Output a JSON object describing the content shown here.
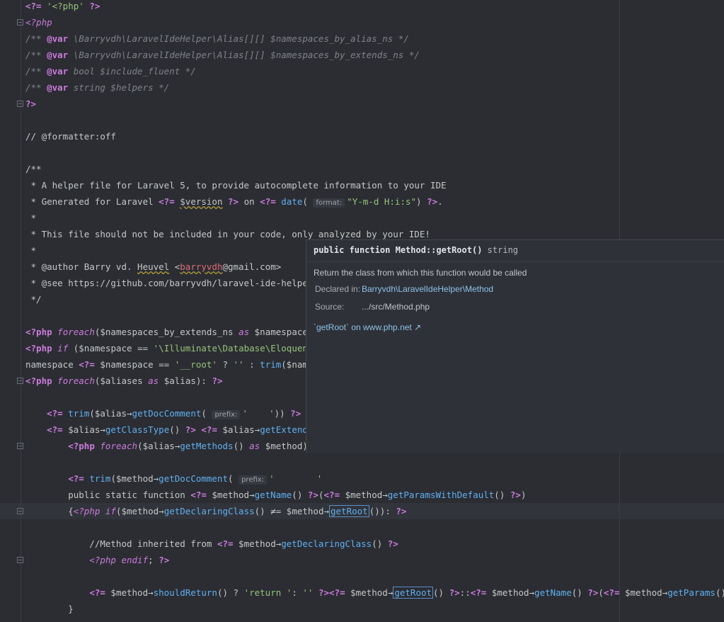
{
  "code_lines": [
    {
      "fold": false,
      "segs": [
        [
          "tag",
          "<?="
        ],
        [
          "v",
          " "
        ],
        [
          "s",
          "'<?php'"
        ],
        [
          "v",
          " "
        ],
        [
          "tag",
          "?>"
        ]
      ]
    },
    {
      "fold": true,
      "segs": [
        [
          "tagi",
          "<?php"
        ]
      ]
    },
    {
      "fold": false,
      "segs": [
        [
          "c",
          "/** "
        ],
        [
          "tag",
          "@var"
        ],
        [
          "c",
          " \\Barryvdh\\LaravelIdeHelper\\Alias[][] $namespaces_by_alias_ns */"
        ]
      ]
    },
    {
      "fold": false,
      "segs": [
        [
          "c",
          "/** "
        ],
        [
          "tag",
          "@var"
        ],
        [
          "c",
          " \\Barryvdh\\LaravelIdeHelper\\Alias[][] $namespaces_by_extends_ns */"
        ]
      ]
    },
    {
      "fold": false,
      "segs": [
        [
          "c",
          "/** "
        ],
        [
          "tag",
          "@var"
        ],
        [
          "c",
          " bool $include_fluent */"
        ]
      ]
    },
    {
      "fold": false,
      "segs": [
        [
          "c",
          "/** "
        ],
        [
          "tag",
          "@var"
        ],
        [
          "c",
          " string $helpers */"
        ]
      ]
    },
    {
      "fold": true,
      "segs": [
        [
          "tag",
          "?>"
        ]
      ]
    },
    {
      "fold": false,
      "segs": []
    },
    {
      "fold": false,
      "segs": [
        [
          "v",
          "// @formatter:off"
        ]
      ]
    },
    {
      "fold": false,
      "segs": []
    },
    {
      "fold": false,
      "segs": [
        [
          "v",
          "/**"
        ]
      ]
    },
    {
      "fold": false,
      "segs": [
        [
          "v",
          " * A helper file for Laravel 5, to provide autocomplete information to your IDE"
        ]
      ]
    },
    {
      "fold": false,
      "segs": [
        [
          "v",
          " * Generated for Laravel "
        ],
        [
          "tag",
          "<?="
        ],
        [
          "v",
          " "
        ],
        [
          "sq",
          "$version"
        ],
        [
          "v",
          " "
        ],
        [
          "tag",
          "?>"
        ],
        [
          "v",
          " on "
        ],
        [
          "tag",
          "<?="
        ],
        [
          "v",
          " "
        ],
        [
          "fn",
          "date"
        ],
        [
          "v",
          "( "
        ],
        [
          "hint",
          "format:"
        ],
        [
          "s",
          "\"Y-m-d H:i:s\""
        ],
        [
          "v",
          ") "
        ],
        [
          "tag",
          "?>"
        ],
        [
          "v",
          "."
        ]
      ]
    },
    {
      "fold": false,
      "segs": [
        [
          "v",
          " *"
        ]
      ]
    },
    {
      "fold": false,
      "segs": [
        [
          "v",
          " * This file should not be included in your code, only analyzed by your IDE!"
        ]
      ]
    },
    {
      "fold": false,
      "segs": [
        [
          "v",
          " *"
        ]
      ]
    },
    {
      "fold": false,
      "segs": [
        [
          "v",
          " * @author Barry vd. "
        ],
        [
          "sq",
          "Heuvel"
        ],
        [
          "v",
          " <"
        ],
        [
          "sqr",
          "barryvdh"
        ],
        [
          "v",
          "@gmail.com>"
        ]
      ]
    },
    {
      "fold": false,
      "segs": [
        [
          "v",
          " * @see https://github.com/barryvdh/laravel-ide-helper"
        ]
      ]
    },
    {
      "fold": false,
      "segs": [
        [
          "v",
          " */"
        ]
      ]
    },
    {
      "fold": false,
      "segs": []
    },
    {
      "fold": false,
      "segs": [
        [
          "tag",
          "<?php"
        ],
        [
          "v",
          " "
        ],
        [
          "kwi",
          "foreach"
        ],
        [
          "v",
          "($namespaces_by_extends_ns "
        ],
        [
          "kwi",
          "as"
        ],
        [
          "v",
          " $namespace ⇒"
        ]
      ]
    },
    {
      "fold": false,
      "segs": [
        [
          "tag",
          "<?php"
        ],
        [
          "v",
          " "
        ],
        [
          "kwi",
          "if"
        ],
        [
          "v",
          " ($namespace == "
        ],
        [
          "s",
          "'\\Illuminate\\Database\\Eloquent'"
        ],
        [
          "v",
          "):"
        ]
      ]
    },
    {
      "fold": false,
      "segs": [
        [
          "v",
          "namespace "
        ],
        [
          "tag",
          "<?="
        ],
        [
          "v",
          " $namespace == "
        ],
        [
          "s",
          "'__root'"
        ],
        [
          "v",
          " ? "
        ],
        [
          "s",
          "''"
        ],
        [
          "v",
          " : "
        ],
        [
          "fn",
          "trim"
        ],
        [
          "v",
          "($namespa"
        ]
      ]
    },
    {
      "fold": true,
      "segs": [
        [
          "tag",
          "<?php"
        ],
        [
          "v",
          " "
        ],
        [
          "kwi",
          "foreach"
        ],
        [
          "v",
          "($aliases "
        ],
        [
          "kwi",
          "as"
        ],
        [
          "v",
          " $alias): "
        ],
        [
          "tag",
          "?>"
        ]
      ]
    },
    {
      "fold": false,
      "segs": []
    },
    {
      "fold": false,
      "segs": [
        [
          "v",
          "    "
        ],
        [
          "tag",
          "<?="
        ],
        [
          "v",
          " "
        ],
        [
          "fn",
          "trim"
        ],
        [
          "v",
          "($alias→"
        ],
        [
          "fn",
          "getDocComment"
        ],
        [
          "v",
          "( "
        ],
        [
          "hint",
          "prefix:"
        ],
        [
          "s",
          "'    '"
        ],
        [
          "v",
          ")) "
        ],
        [
          "tag",
          "?>"
        ]
      ]
    },
    {
      "fold": false,
      "segs": [
        [
          "v",
          "    "
        ],
        [
          "tag",
          "<?="
        ],
        [
          "v",
          " $alias→"
        ],
        [
          "fn",
          "getClassType"
        ],
        [
          "v",
          "() "
        ],
        [
          "tag",
          "?>"
        ],
        [
          "v",
          " "
        ],
        [
          "tag",
          "<?="
        ],
        [
          "v",
          " $alias→"
        ],
        [
          "fn",
          "getExtendsC"
        ]
      ]
    },
    {
      "fold": true,
      "segs": [
        [
          "v",
          "        "
        ],
        [
          "tag",
          "<?php"
        ],
        [
          "v",
          " "
        ],
        [
          "kwi",
          "foreach"
        ],
        [
          "v",
          "($alias→"
        ],
        [
          "fn",
          "getMethods"
        ],
        [
          "v",
          "() "
        ],
        [
          "kwi",
          "as"
        ],
        [
          "v",
          " $method): "
        ],
        [
          "tag",
          "?"
        ]
      ]
    },
    {
      "fold": false,
      "segs": []
    },
    {
      "fold": false,
      "segs": [
        [
          "v",
          "        "
        ],
        [
          "tag",
          "<?="
        ],
        [
          "v",
          " "
        ],
        [
          "fn",
          "trim"
        ],
        [
          "v",
          "($method→"
        ],
        [
          "fn",
          "getDocComment"
        ],
        [
          "v",
          "( "
        ],
        [
          "hint",
          "prefix:"
        ],
        [
          "s",
          "'        '"
        ]
      ]
    },
    {
      "fold": false,
      "segs": [
        [
          "v",
          "        public static function "
        ],
        [
          "tag",
          "<?="
        ],
        [
          "v",
          " $method→"
        ],
        [
          "fn",
          "getName"
        ],
        [
          "v",
          "() "
        ],
        [
          "tag",
          "?>"
        ],
        [
          "v",
          "("
        ],
        [
          "tag",
          "<?="
        ],
        [
          "v",
          " $method→"
        ],
        [
          "fn",
          "getParamsWithDefault"
        ],
        [
          "v",
          "() "
        ],
        [
          "tag",
          "?>"
        ],
        [
          "v",
          ")"
        ]
      ]
    },
    {
      "fold": true,
      "segs": [
        [
          "v",
          "        {"
        ],
        [
          "tagi",
          "<?php"
        ],
        [
          "v",
          " "
        ],
        [
          "kwi",
          "if"
        ],
        [
          "v",
          "($method→"
        ],
        [
          "fn",
          "getDeclaringClass"
        ],
        [
          "v",
          "() ≠= $method→"
        ],
        [
          "hlfn",
          "getRoot"
        ],
        [
          "v",
          "()): "
        ],
        [
          "tag",
          "?>"
        ]
      ]
    },
    {
      "fold": false,
      "segs": []
    },
    {
      "fold": false,
      "segs": [
        [
          "v",
          "            //Method inherited from "
        ],
        [
          "tag",
          "<?="
        ],
        [
          "v",
          " $method→"
        ],
        [
          "fn",
          "getDeclaringClass"
        ],
        [
          "v",
          "() "
        ],
        [
          "tag",
          "?>"
        ]
      ]
    },
    {
      "fold": true,
      "segs": [
        [
          "v",
          "            "
        ],
        [
          "tagi",
          "<?php"
        ],
        [
          "v",
          " "
        ],
        [
          "kwi",
          "endif"
        ],
        [
          "v",
          "; "
        ],
        [
          "tag",
          "?>"
        ]
      ]
    },
    {
      "fold": false,
      "segs": []
    },
    {
      "fold": false,
      "segs": [
        [
          "v",
          "            "
        ],
        [
          "tag",
          "<?="
        ],
        [
          "v",
          " $method→"
        ],
        [
          "fn",
          "shouldReturn"
        ],
        [
          "v",
          "() ? "
        ],
        [
          "s",
          "'return '"
        ],
        [
          "v",
          ": "
        ],
        [
          "s",
          "''"
        ],
        [
          "v",
          " "
        ],
        [
          "tag",
          "?>"
        ],
        [
          "tag",
          "<?="
        ],
        [
          "v",
          " $method→"
        ],
        [
          "hlfn",
          "getRoot"
        ],
        [
          "v",
          "() "
        ],
        [
          "tag",
          "?>"
        ],
        [
          "v",
          "::"
        ],
        [
          "tag",
          "<?="
        ],
        [
          "v",
          " $method→"
        ],
        [
          "fn",
          "getName"
        ],
        [
          "v",
          "() "
        ],
        [
          "tag",
          "?>"
        ],
        [
          "v",
          "("
        ],
        [
          "tag",
          "<?="
        ],
        [
          "v",
          " $method→"
        ],
        [
          "fn",
          "getParams"
        ],
        [
          "v",
          "() "
        ],
        [
          "tag",
          "?>"
        ],
        [
          "v",
          ");"
        ]
      ]
    },
    {
      "fold": false,
      "segs": [
        [
          "v",
          "        }"
        ]
      ]
    }
  ],
  "popup": {
    "keyword": "public function",
    "name": "Method::getRoot()",
    "return_type": "string",
    "description": "Return the class from which this function would be called",
    "declared_label": "Declared in:",
    "declared_value": "Barryvdh\\LaravelIdeHelper\\Method",
    "source_label": "Source:",
    "source_value": ".../src/Method.php",
    "doc_link": "`getRoot` on www.php.net ↗"
  }
}
